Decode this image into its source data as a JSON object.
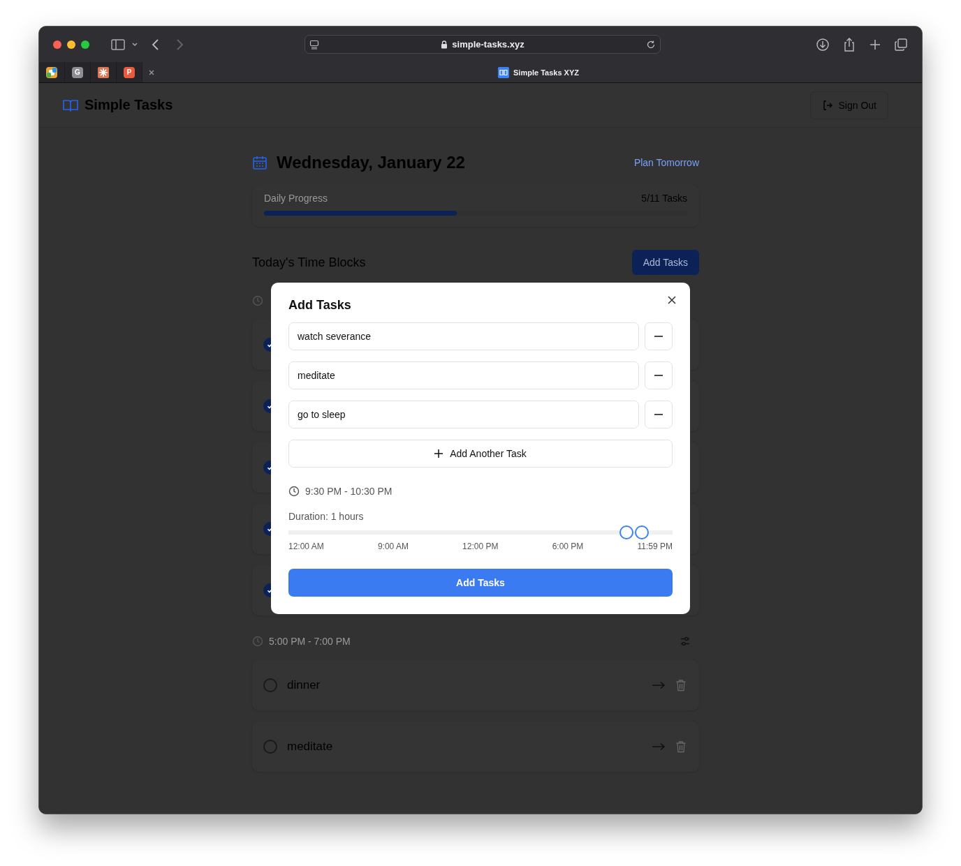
{
  "browser": {
    "url": "simple-tasks.xyz",
    "tabs": [
      {
        "kind": "favicon",
        "color": "#e8a33a",
        "selected": false
      },
      {
        "kind": "favicon",
        "label": "G",
        "color": "#8e8e93",
        "selected": false
      },
      {
        "kind": "favicon",
        "color": "#d97757",
        "selected": false
      },
      {
        "kind": "favicon",
        "label": "P",
        "color": "#ea5a3d",
        "selected": false
      },
      {
        "kind": "page",
        "label": "Simple Tasks XYZ",
        "color": "#3b82f6",
        "selected": true
      }
    ]
  },
  "app": {
    "name": "Simple Tasks",
    "sign_out": "Sign Out"
  },
  "day": {
    "title": "Wednesday, January 22",
    "plan_link": "Plan Tomorrow",
    "progress_label": "Daily Progress",
    "progress_count": "5/11 Tasks",
    "level": 0.455
  },
  "section": {
    "title": "Today's Time Blocks",
    "add_button": "Add Tasks"
  },
  "time_blocks": [
    {
      "tasks": [
        {
          "checked": true
        },
        {
          "checked": true
        },
        {
          "checked": true
        },
        {
          "checked": true
        },
        {
          "checked": true
        }
      ]
    },
    {
      "time": "5:00 PM - 7:00 PM",
      "tasks": [
        {
          "name": "dinner",
          "checked": false
        },
        {
          "name": "meditate",
          "checked": false
        }
      ]
    }
  ],
  "dialog": {
    "title": "Add Tasks",
    "tasks": [
      {
        "value": "watch severance"
      },
      {
        "value": "meditate"
      },
      {
        "value": "go to sleep"
      }
    ],
    "add_another": "Add Another Task",
    "time_range": "9:30 PM - 10:30 PM",
    "duration": "Duration: 1 hours",
    "slider": {
      "thumbs": [
        {
          "level": 0.88
        },
        {
          "level": 0.92
        }
      ],
      "ticks": [
        "12:00 AM",
        "9:00 AM",
        "12:00 PM",
        "6:00 PM",
        "11:59 PM"
      ]
    },
    "submit": "Add Tasks"
  }
}
